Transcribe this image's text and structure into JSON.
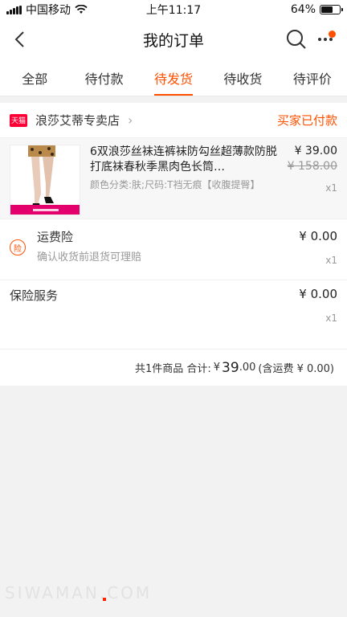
{
  "status_bar": {
    "carrier": "中国移动",
    "time": "上午11:17",
    "battery": "64%",
    "battery_level": 0.64
  },
  "navbar": {
    "title": "我的订单",
    "icons": [
      "back-arrow-icon",
      "search-icon",
      "more-icon"
    ]
  },
  "tabs": [
    {
      "label": "全部",
      "active": false
    },
    {
      "label": "待付款",
      "active": false
    },
    {
      "label": "待发货",
      "active": true
    },
    {
      "label": "待收货",
      "active": false
    },
    {
      "label": "待评价",
      "active": false
    }
  ],
  "order": {
    "badge": "天猫",
    "shop_name": "浪莎艾蒂专卖店",
    "status": "买家已付款",
    "product": {
      "title": "6双浪莎丝袜连裤袜防勾丝超薄款防脱打底袜春秋季黑肉色长筒…",
      "sku": "颜色分类:肤;尺码:T裆无痕【收腹提臀】",
      "price": "¥ 39.00",
      "original_price": "¥ 158.00",
      "qty": "x1"
    },
    "insurance": {
      "icon_label": "险",
      "title": "运费险",
      "subtitle": "确认收货前退货可理赔",
      "price": "¥ 0.00",
      "qty": "x1"
    },
    "service": {
      "title": "保险服务",
      "price": "¥ 0.00",
      "qty": "x1"
    },
    "summary": {
      "count_text": "共1件商品 合计:",
      "currency": "¥",
      "amount_big": "39",
      "amount_small": ".00",
      "freight_note": "(含运费 ¥ 0.00)"
    }
  },
  "watermark": {
    "text": "SIWAMAN.COM"
  },
  "colors": {
    "accent": "#ff5000",
    "tmall": "#ff0036"
  }
}
